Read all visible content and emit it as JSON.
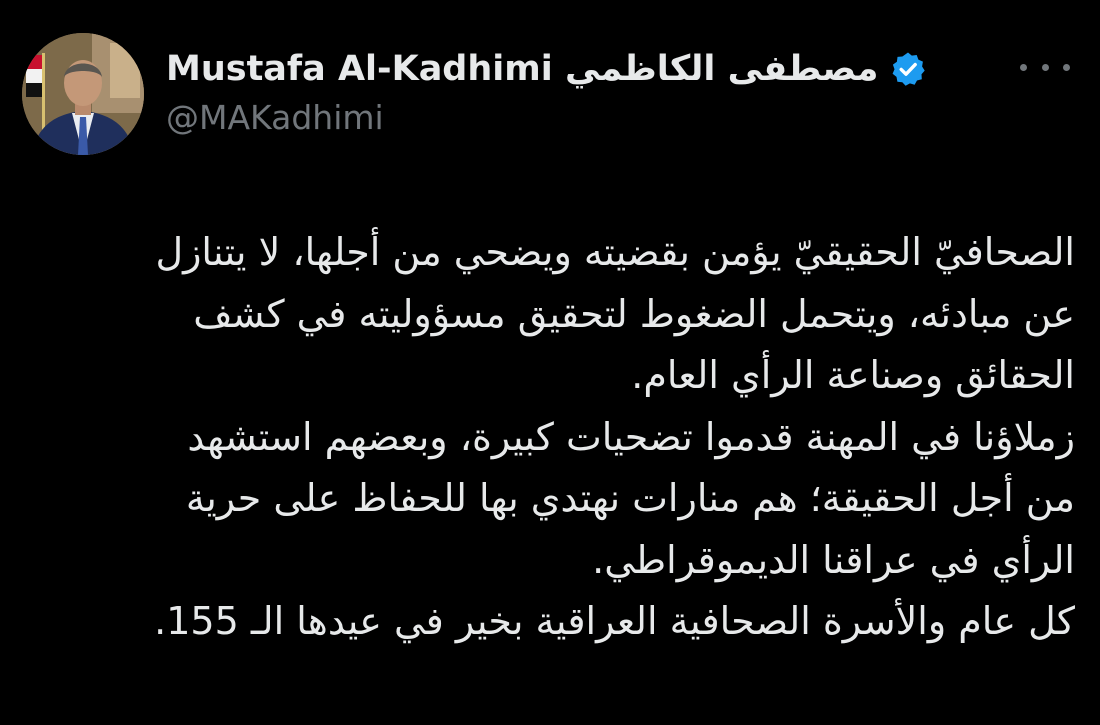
{
  "author": {
    "display_name": "Mustafa Al-Kadhimi مصطفى الكاظمي",
    "handle": "@MAKadhimi",
    "verified": true,
    "verified_icon": "verified-badge-icon",
    "avatar_icon": "profile-photo"
  },
  "more_menu": {
    "icon": "more-horizontal-icon"
  },
  "tweet": {
    "lines": [
      "الصحافيّ الحقيقيّ يؤمن بقضيته ويضحي من أجلها، لا يتنازل",
      "عن مبادئه، ويتحمل الضغوط لتحقيق مسؤوليته في كشف",
      "الحقائق وصناعة الرأي العام.",
      "زملاؤنا في المهنة قدموا تضحيات كبيرة، وبعضهم استشهد",
      "من أجل الحقيقة؛ هم منارات نهتدي بها للحفاظ على حرية",
      "الرأي في عراقنا الديموقراطي.",
      "كل عام والأسرة الصحافية العراقية بخير في عيدها الـ 155."
    ]
  },
  "colors": {
    "background": "#000000",
    "text_primary": "#e7e9ea",
    "text_secondary": "#71767b",
    "verified_blue": "#1d9bf0"
  }
}
